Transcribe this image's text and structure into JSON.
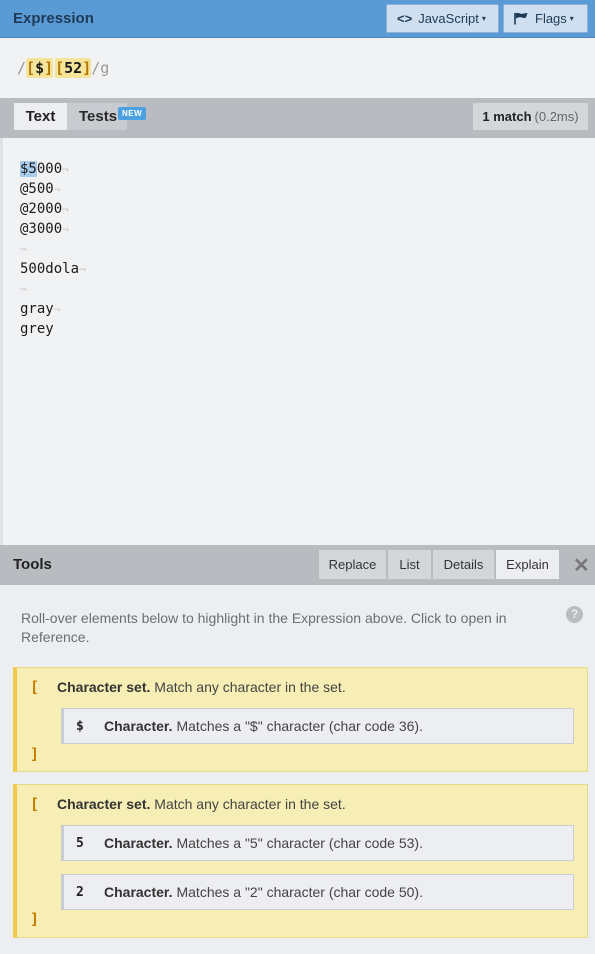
{
  "header": {
    "title": "Expression",
    "flavor_icon": "code-icon",
    "flavor_glyph": "<>",
    "flavor_label": "JavaScript",
    "flags_icon": "flag-icon",
    "flags_label": "Flags",
    "caret": "▾"
  },
  "expression": {
    "open_slash": "/",
    "sets": [
      {
        "open": "[",
        "chars": "$",
        "close": "]"
      },
      {
        "open": "[",
        "chars": "52",
        "close": "]"
      }
    ],
    "close_slash_flags": "/g"
  },
  "text_panel": {
    "tabs": [
      {
        "label": "Text"
      },
      {
        "label": "Tests"
      }
    ],
    "new_badge": "NEW",
    "match_count": "1 match",
    "match_time": "(0.2ms)",
    "newline_glyph": "¬",
    "lines": [
      {
        "highlight": "$5",
        "rest": "000"
      },
      {
        "highlight": "",
        "rest": "@500"
      },
      {
        "highlight": "",
        "rest": "@2000"
      },
      {
        "highlight": "",
        "rest": "@3000"
      },
      {
        "highlight": "",
        "rest": ""
      },
      {
        "highlight": "",
        "rest": "500dola"
      },
      {
        "highlight": "",
        "rest": ""
      },
      {
        "highlight": "",
        "rest": "gray"
      },
      {
        "highlight": "",
        "rest": "grey"
      }
    ]
  },
  "tools": {
    "title": "Tools",
    "tabs": [
      {
        "label": "Replace"
      },
      {
        "label": "List"
      },
      {
        "label": "Details"
      },
      {
        "label": "Explain"
      }
    ],
    "active_tab": "Explain",
    "close_glyph": "✕",
    "hint": "Roll-over elements below to highlight in the Expression above. Click to open in Reference.",
    "help_glyph": "?",
    "blocks": [
      {
        "open": "[",
        "close": "]",
        "title": "Character set.",
        "desc": "Match any character in the set.",
        "items": [
          {
            "char": "$",
            "title": "Character.",
            "desc": "Matches a \"$\" character (char code 36)."
          }
        ]
      },
      {
        "open": "[",
        "close": "]",
        "title": "Character set.",
        "desc": "Match any character in the set.",
        "items": [
          {
            "char": "5",
            "title": "Character.",
            "desc": "Matches a \"5\" character (char code 53)."
          },
          {
            "char": "2",
            "title": "Character.",
            "desc": "Matches a \"2\" character (char code 50)."
          }
        ]
      }
    ]
  }
}
